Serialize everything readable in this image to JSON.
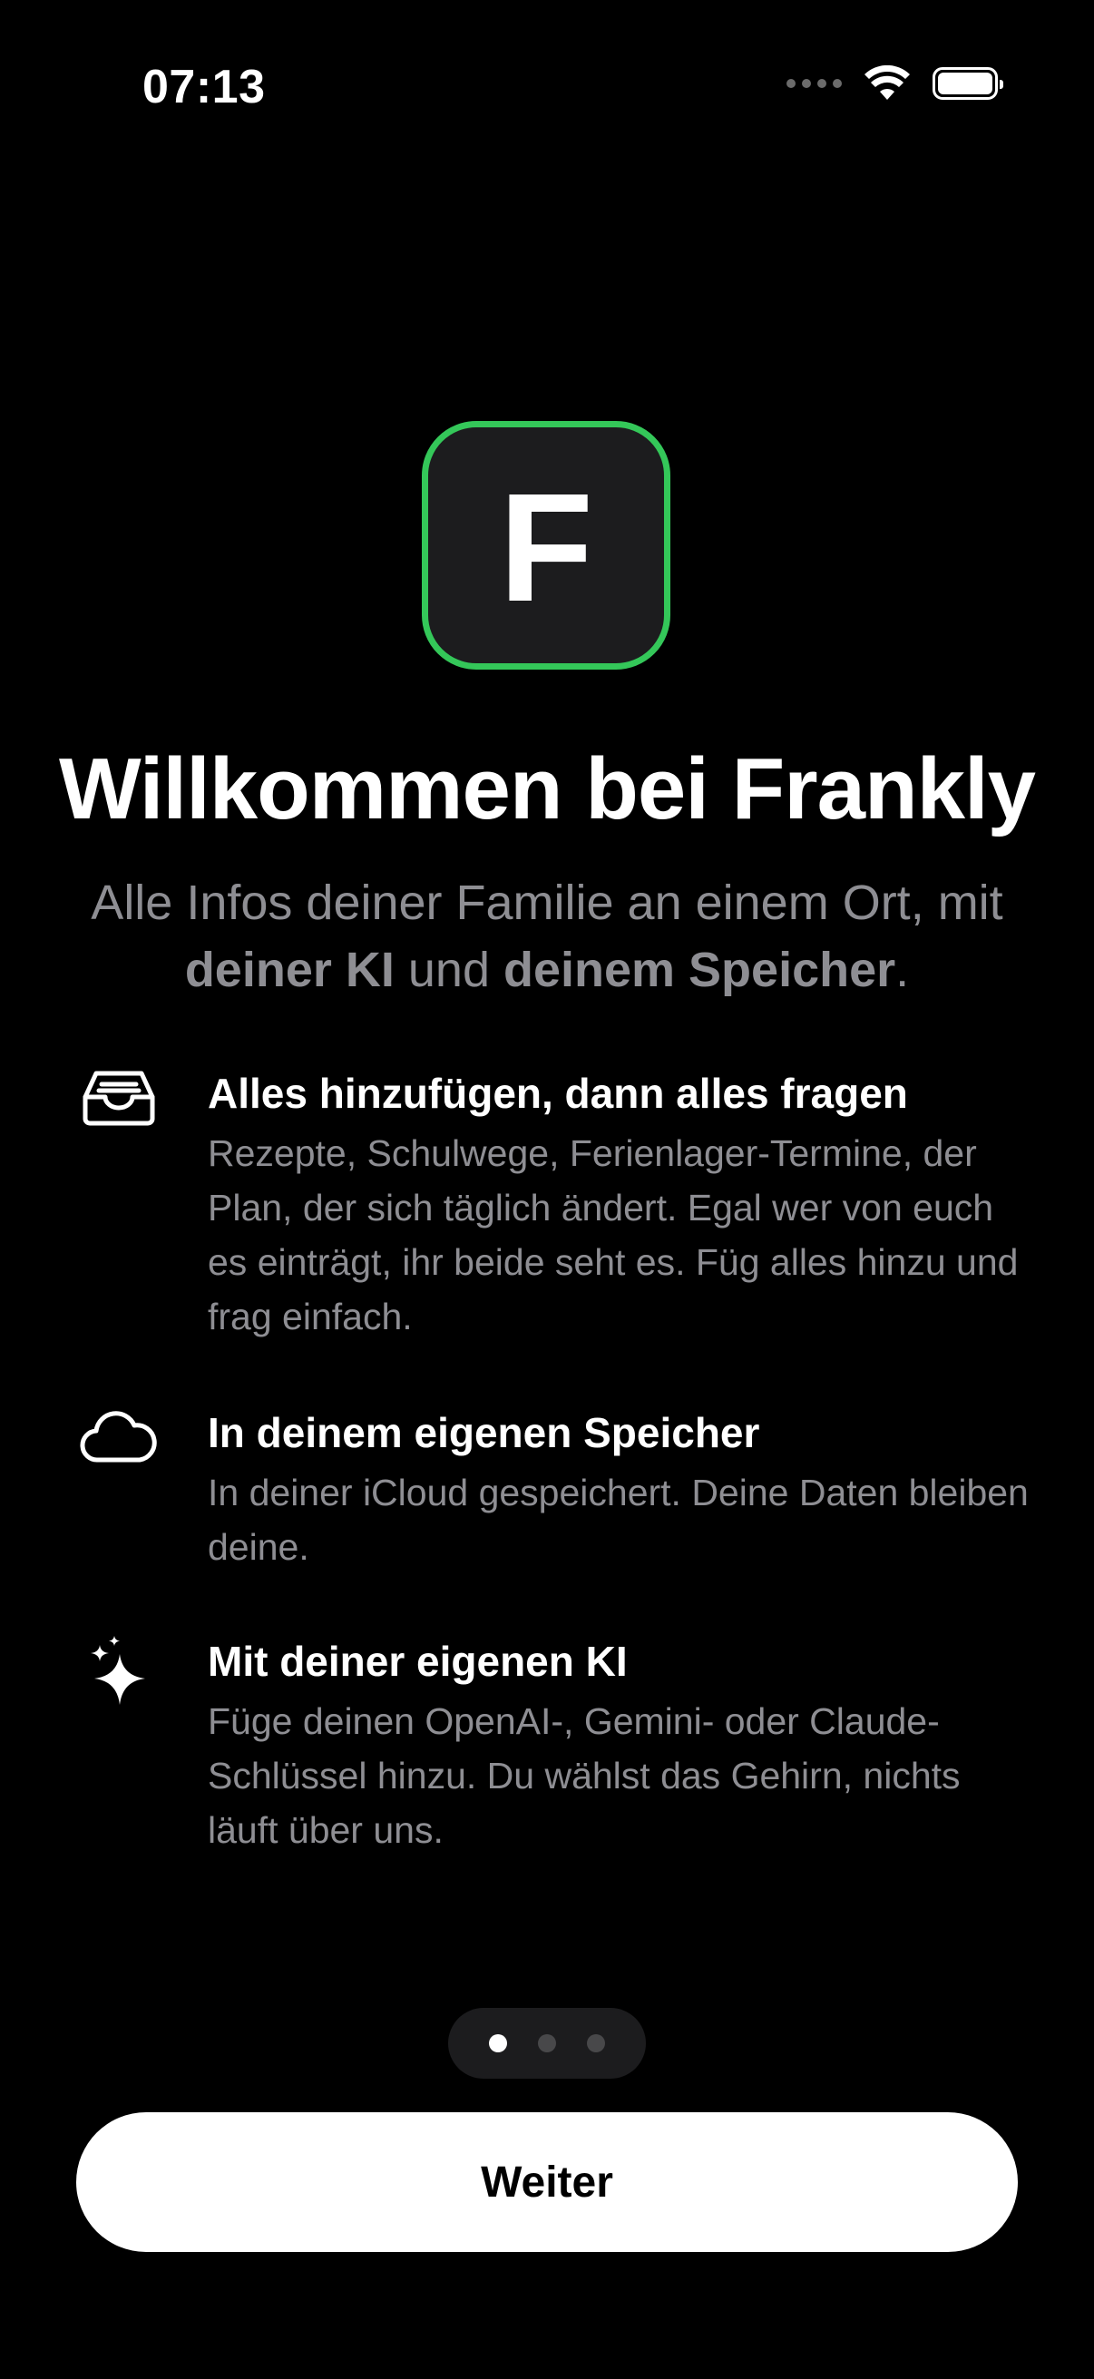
{
  "status_bar": {
    "time": "07:13"
  },
  "logo": {
    "letter": "F",
    "accent_color": "#34c759"
  },
  "title": "Willkommen bei Frankly",
  "subtitle": {
    "part1": "Alle Infos deiner Familie an einem Ort, mit ",
    "bold1": "deiner KI",
    "part2": " und ",
    "bold2": "deinem Speicher",
    "part3": "."
  },
  "features": [
    {
      "icon": "tray-icon",
      "title": "Alles hinzufügen, dann alles fragen",
      "description": "Rezepte, Schulwege, Ferienlager-Termine, der Plan, der sich täglich ändert. Egal wer von euch es einträgt, ihr beide seht es. Füg alles hinzu und frag einfach."
    },
    {
      "icon": "cloud-icon",
      "title": "In deinem eigenen Speicher",
      "description": "In deiner iCloud gespeichert. Deine Daten bleiben deine."
    },
    {
      "icon": "sparkles-icon",
      "title": "Mit deiner eigenen KI",
      "description": "Füge deinen OpenAI-, Gemini- oder Claude-Schlüssel hinzu. Du wählst das Gehirn, nichts läuft über uns."
    }
  ],
  "pager": {
    "current_page": 1,
    "total_pages": 3
  },
  "continue_label": "Weiter"
}
